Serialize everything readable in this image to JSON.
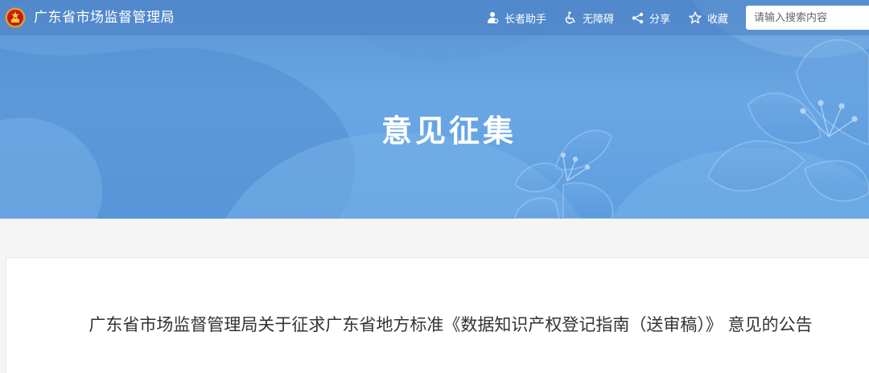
{
  "header": {
    "site_title": "广东省市场监督管理局",
    "tools": [
      {
        "label": "长者助手",
        "icon": "elder-assistant-icon"
      },
      {
        "label": "无障碍",
        "icon": "wheelchair-icon"
      },
      {
        "label": "分享",
        "icon": "share-icon"
      },
      {
        "label": "收藏",
        "icon": "star-icon"
      }
    ],
    "search_placeholder": "请输入搜索内容"
  },
  "banner": {
    "title": "意见征集"
  },
  "article": {
    "title": "广东省市场监督管理局关于征求广东省地方标准《数据知识产权登记指南（送审稿）》 意见的公告"
  },
  "colors": {
    "banner_blue": "#6aa6e4",
    "topbar": "#4880c4",
    "page_bg": "#f5f5f5",
    "title_text": "#333333"
  }
}
